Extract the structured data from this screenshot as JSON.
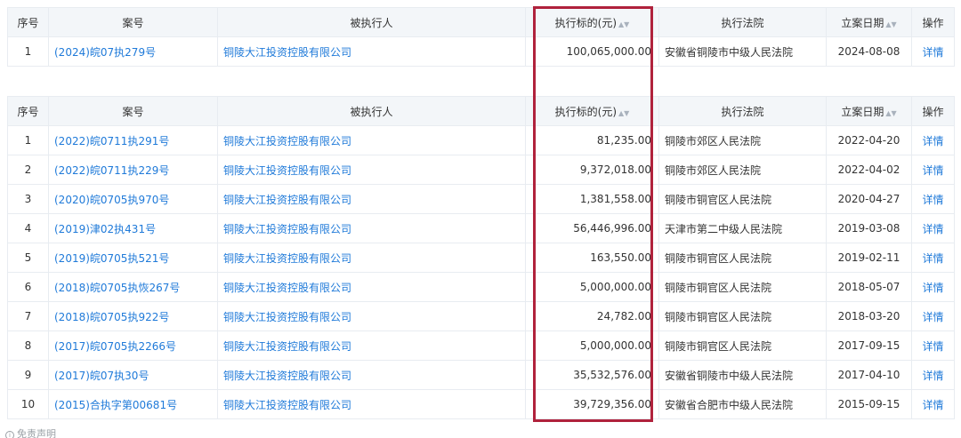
{
  "colors": {
    "link": "#1f7ad9",
    "header_bg": "#f3f6f9",
    "highlight": "#b0223c"
  },
  "headers": {
    "index": "序号",
    "case_no": "案号",
    "party": "被执行人",
    "amount": "执行标的(元)",
    "court": "执行法院",
    "filing_date": "立案日期",
    "operation": "操作"
  },
  "table1": {
    "rows": [
      {
        "index": "1",
        "case_no": "(2024)皖07执279号",
        "party": "铜陵大江投资控股有限公司",
        "amount": "100,065,000.00",
        "court": "安徽省铜陵市中级人民法院",
        "date": "2024-08-08",
        "op": "详情"
      }
    ]
  },
  "table2": {
    "rows": [
      {
        "index": "1",
        "case_no": "(2022)皖0711执291号",
        "party": "铜陵大江投资控股有限公司",
        "amount": "81,235.00",
        "court": "铜陵市郊区人民法院",
        "date": "2022-04-20",
        "op": "详情"
      },
      {
        "index": "2",
        "case_no": "(2022)皖0711执229号",
        "party": "铜陵大江投资控股有限公司",
        "amount": "9,372,018.00",
        "court": "铜陵市郊区人民法院",
        "date": "2022-04-02",
        "op": "详情"
      },
      {
        "index": "3",
        "case_no": "(2020)皖0705执970号",
        "party": "铜陵大江投资控股有限公司",
        "amount": "1,381,558.00",
        "court": "铜陵市铜官区人民法院",
        "date": "2020-04-27",
        "op": "详情"
      },
      {
        "index": "4",
        "case_no": "(2019)津02执431号",
        "party": "铜陵大江投资控股有限公司",
        "amount": "56,446,996.00",
        "court": "天津市第二中级人民法院",
        "date": "2019-03-08",
        "op": "详情"
      },
      {
        "index": "5",
        "case_no": "(2019)皖0705执521号",
        "party": "铜陵大江投资控股有限公司",
        "amount": "163,550.00",
        "court": "铜陵市铜官区人民法院",
        "date": "2019-02-11",
        "op": "详情"
      },
      {
        "index": "6",
        "case_no": "(2018)皖0705执恢267号",
        "party": "铜陵大江投资控股有限公司",
        "amount": "5,000,000.00",
        "court": "铜陵市铜官区人民法院",
        "date": "2018-05-07",
        "op": "详情"
      },
      {
        "index": "7",
        "case_no": "(2018)皖0705执922号",
        "party": "铜陵大江投资控股有限公司",
        "amount": "24,782.00",
        "court": "铜陵市铜官区人民法院",
        "date": "2018-03-20",
        "op": "详情"
      },
      {
        "index": "8",
        "case_no": "(2017)皖0705执2266号",
        "party": "铜陵大江投资控股有限公司",
        "amount": "5,000,000.00",
        "court": "铜陵市铜官区人民法院",
        "date": "2017-09-15",
        "op": "详情"
      },
      {
        "index": "9",
        "case_no": "(2017)皖07执30号",
        "party": "铜陵大江投资控股有限公司",
        "amount": "35,532,576.00",
        "court": "安徽省铜陵市中级人民法院",
        "date": "2017-04-10",
        "op": "详情"
      },
      {
        "index": "10",
        "case_no": "(2015)合执字第00681号",
        "party": "铜陵大江投资控股有限公司",
        "amount": "39,729,356.00",
        "court": "安徽省合肥市中级人民法院",
        "date": "2015-09-15",
        "op": "详情"
      }
    ]
  },
  "disclaimer": "免责声明"
}
